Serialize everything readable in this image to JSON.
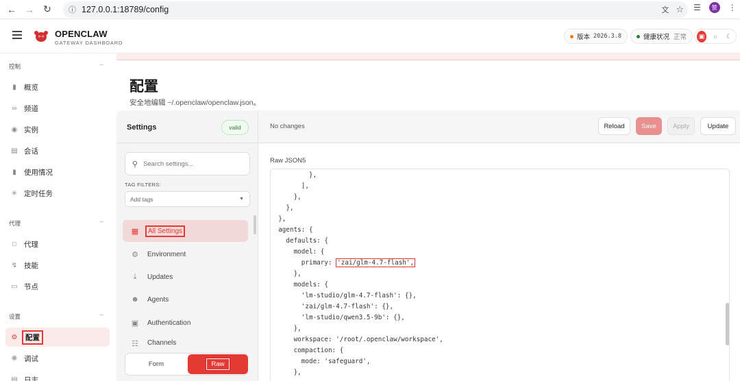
{
  "browser": {
    "url": "127.0.0.1:18789/config",
    "profile_initial": "赞"
  },
  "header": {
    "brand_title": "OPENCLAW",
    "brand_subtitle": "GATEWAY DASHBOARD",
    "version_label": "版本",
    "version_value": "2026.3.8",
    "health_label": "健康状况",
    "health_value": "正常",
    "version_dot_color": "#f57c00",
    "health_dot_color": "#2e7d32"
  },
  "sidebar": {
    "sections": [
      {
        "title": "控制",
        "items": [
          {
            "label": "概览",
            "icon": "bar-chart-icon"
          },
          {
            "label": "频道",
            "icon": "link-icon"
          },
          {
            "label": "实例",
            "icon": "radio-icon"
          },
          {
            "label": "会话",
            "icon": "document-icon"
          },
          {
            "label": "使用情况",
            "icon": "bar-chart-icon"
          },
          {
            "label": "定时任务",
            "icon": "loader-icon"
          }
        ]
      },
      {
        "title": "代理",
        "items": [
          {
            "label": "代理",
            "icon": "folder-icon"
          },
          {
            "label": "技能",
            "icon": "bolt-icon"
          },
          {
            "label": "节点",
            "icon": "monitor-icon"
          }
        ]
      },
      {
        "title": "设置",
        "items": [
          {
            "label": "配置",
            "icon": "gear-icon",
            "active": true
          },
          {
            "label": "调试",
            "icon": "bug-icon"
          },
          {
            "label": "日志",
            "icon": "document-icon"
          }
        ]
      }
    ]
  },
  "page": {
    "title": "配置",
    "subtitle": "安全地编辑 ~/.openclaw/openclaw.json。"
  },
  "settings_panel": {
    "title": "Settings",
    "status_badge": "valid",
    "search_placeholder": "Search settings...",
    "tag_filters_label": "TAG FILTERS:",
    "tag_placeholder": "Add tags",
    "categories": [
      {
        "label": "All Settings",
        "icon": "grid-icon",
        "active": true
      },
      {
        "label": "Environment",
        "icon": "gear-icon"
      },
      {
        "label": "Updates",
        "icon": "download-icon"
      },
      {
        "label": "Agents",
        "icon": "agents-icon"
      },
      {
        "label": "Authentication",
        "icon": "lock-icon"
      },
      {
        "label": "Channels",
        "icon": "channels-icon"
      }
    ],
    "mode_form": "Form",
    "mode_raw": "Raw",
    "mode_selected": "Raw"
  },
  "editor": {
    "status": "No changes",
    "buttons": {
      "reload": "Reload",
      "save": "Save",
      "apply": "Apply",
      "update": "Update"
    },
    "raw_label": "Raw JSON5",
    "lines": [
      "          },",
      "        ],",
      "      },",
      "    },",
      "  },",
      "  agents: {",
      "    defaults: {",
      "      model: {",
      "        primary: ",
      "      },",
      "      models: {",
      "        'lm-studio/glm-4.7-flash': {},",
      "        'zai/glm-4.7-flash': {},",
      "        'lm-studio/qwen3.5-9b': {},",
      "      },",
      "      workspace: '/root/.openclaw/workspace',",
      "      compaction: {",
      "        mode: 'safeguard',",
      "      },"
    ],
    "highlight_value": "'zai/glm-4.7-flash',"
  }
}
